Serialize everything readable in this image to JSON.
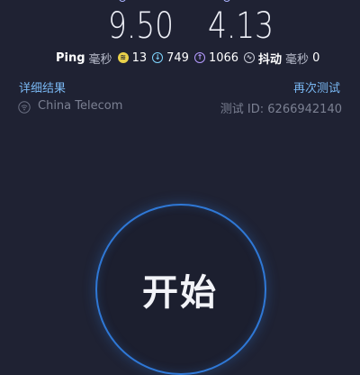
{
  "results": {
    "download_value": "9.50",
    "upload_value": "4.13"
  },
  "stats": {
    "ping_label": "Ping",
    "ping_unit": "毫秒",
    "ping_value": "13",
    "download_ping_value": "749",
    "upload_ping_value": "1066",
    "jitter_label": "抖动",
    "jitter_unit": "毫秒",
    "jitter_value": "0"
  },
  "links": {
    "details": "详细结果",
    "retest": "再次测试"
  },
  "connection": {
    "provider": "China Telecom",
    "test_id": "测试 ID: 6266942140"
  },
  "action": {
    "start_label": "开始"
  },
  "colors": {
    "background": "#1f2233",
    "link": "#79b7f2",
    "ring": "#2f78d6"
  }
}
